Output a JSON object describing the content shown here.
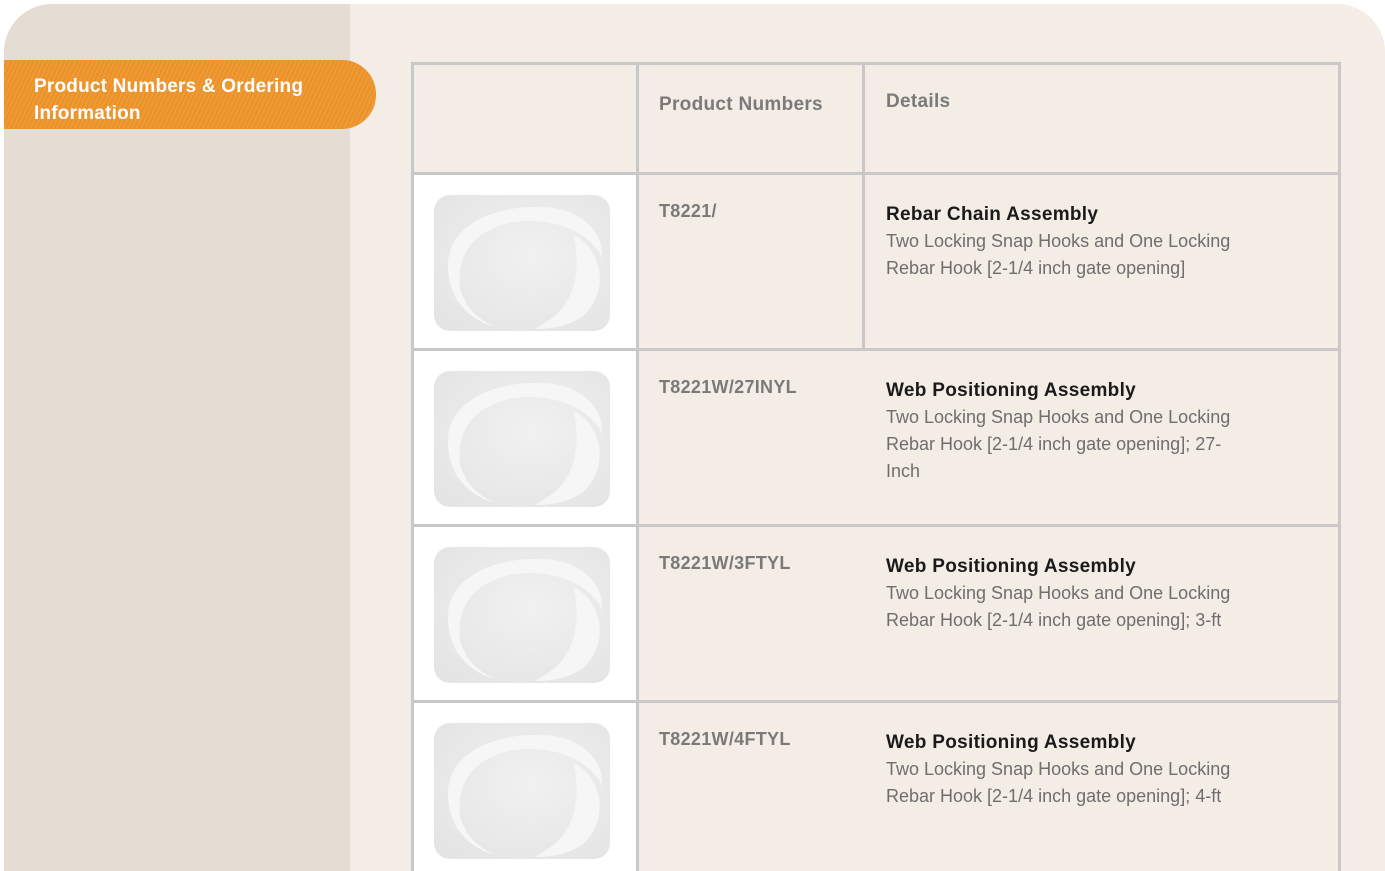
{
  "sidebar": {
    "section_tab": "Product Numbers & Ordering Information"
  },
  "table": {
    "headers": {
      "image": "",
      "product_numbers": "Product Numbers",
      "details": "Details"
    },
    "rows": [
      {
        "product_number": "T8221/",
        "title": "Rebar Chain Assembly",
        "description": "Two Locking Snap Hooks and One Locking Rebar Hook [2-1/4 inch gate opening]",
        "thumbnail": "placeholder-image-icon"
      },
      {
        "product_number": "T8221W/27INYL",
        "title": "Web Positioning Assembly",
        "description": "Two Locking Snap Hooks and One Locking Rebar Hook [2-1/4 inch gate opening]; 27-Inch",
        "thumbnail": "placeholder-image-icon"
      },
      {
        "product_number": "T8221W/3FTYL",
        "title": "Web Positioning Assembly",
        "description": "Two Locking Snap Hooks and One Locking Rebar Hook [2-1/4 inch gate opening]; 3-ft",
        "thumbnail": "placeholder-image-icon"
      },
      {
        "product_number": "T8221W/4FTYL",
        "title": "Web Positioning Assembly",
        "description": "Two Locking Snap Hooks and One Locking Rebar Hook [2-1/4 inch gate opening]; 4-ft",
        "thumbnail": "placeholder-image-icon"
      }
    ]
  },
  "colors": {
    "accent": "#ef9a34",
    "page_bg": "#f4ede5",
    "sidebar_bg": "#e5ddd4",
    "border": "#c8c8c8"
  }
}
